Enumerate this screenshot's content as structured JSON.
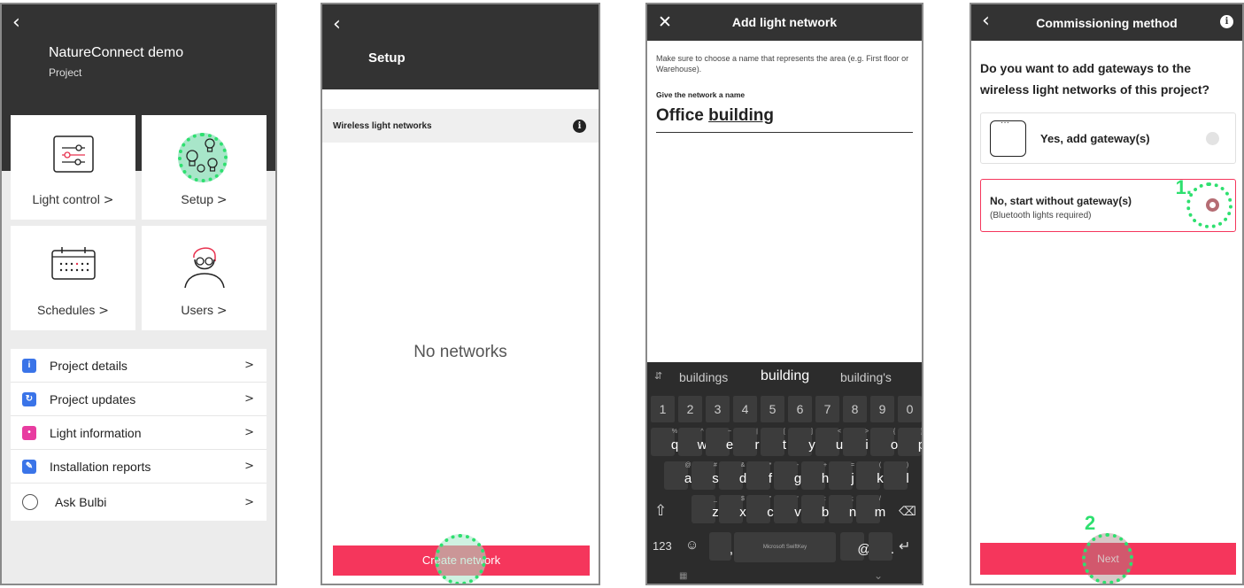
{
  "screen1": {
    "project_name": "NatureConnect demo",
    "project_subtitle": "Project",
    "tiles": [
      {
        "label": "Light control",
        "icon": "sliders-icon"
      },
      {
        "label": "Setup",
        "icon": "lightbulbs-icon"
      },
      {
        "label": "Schedules",
        "icon": "calendar-icon"
      },
      {
        "label": "Users",
        "icon": "user-icon"
      }
    ],
    "chevron": ">",
    "menu": [
      {
        "label": "Project details",
        "icon": "info-icon",
        "color": "#3a74e8"
      },
      {
        "label": "Project updates",
        "icon": "refresh-icon",
        "color": "#3a74e8"
      },
      {
        "label": "Light information",
        "icon": "light-info-icon",
        "color": "#e83ca0"
      },
      {
        "label": "Installation reports",
        "icon": "report-icon",
        "color": "#3a74e8"
      },
      {
        "label": "Ask Bulbi",
        "icon": "bulbi-icon",
        "color": "#ffffff"
      }
    ]
  },
  "screen2": {
    "title": "Setup",
    "section_label": "Wireless light networks",
    "empty_text": "No networks",
    "button_label": "Create network"
  },
  "screen3": {
    "title": "Add light network",
    "hint": "Make sure to choose a name that represents the area (e.g. First floor or Warehouse).",
    "field_label": "Give the network a name",
    "field_value_plain": "Office ",
    "field_value_underlined": "building",
    "suggestions": [
      "buildings",
      "building",
      "building's"
    ],
    "number_row": [
      "1",
      "2",
      "3",
      "4",
      "5",
      "6",
      "7",
      "8",
      "9",
      "0"
    ],
    "row1": [
      [
        "q",
        "%"
      ],
      [
        "w",
        "^"
      ],
      [
        "e",
        "~"
      ],
      [
        "r",
        "|"
      ],
      [
        "t",
        "["
      ],
      [
        "y",
        "]"
      ],
      [
        "u",
        "<"
      ],
      [
        "i",
        ">"
      ],
      [
        "o",
        "{"
      ],
      [
        "p",
        "}"
      ]
    ],
    "row2": [
      [
        "a",
        "@"
      ],
      [
        "s",
        "#"
      ],
      [
        "d",
        "&"
      ],
      [
        "f",
        "*"
      ],
      [
        "g",
        "-"
      ],
      [
        "h",
        "+"
      ],
      [
        "j",
        "="
      ],
      [
        "k",
        "("
      ],
      [
        "l",
        ")"
      ]
    ],
    "row3": [
      [
        "z",
        "_"
      ],
      [
        "x",
        "$"
      ],
      [
        "c",
        "\""
      ],
      [
        "v",
        "'"
      ],
      [
        "b",
        ":"
      ],
      [
        "n",
        ";"
      ],
      [
        "m",
        "/"
      ]
    ],
    "space_label": "Microsoft SwiftKey",
    "mode_label": "123"
  },
  "screen4": {
    "title": "Commissioning method",
    "question": "Do you want to add gateways to the wireless light networks of this project?",
    "option1": "Yes, add gateway(s)",
    "option2": "No, start without gateway(s)",
    "option2_sub": "(Bluetooth lights required)",
    "button_label": "Next",
    "step1": "1.",
    "step2": "2"
  },
  "colors": {
    "accent": "#f5365c",
    "dark": "#333333",
    "highlight": "#2ee06f"
  }
}
